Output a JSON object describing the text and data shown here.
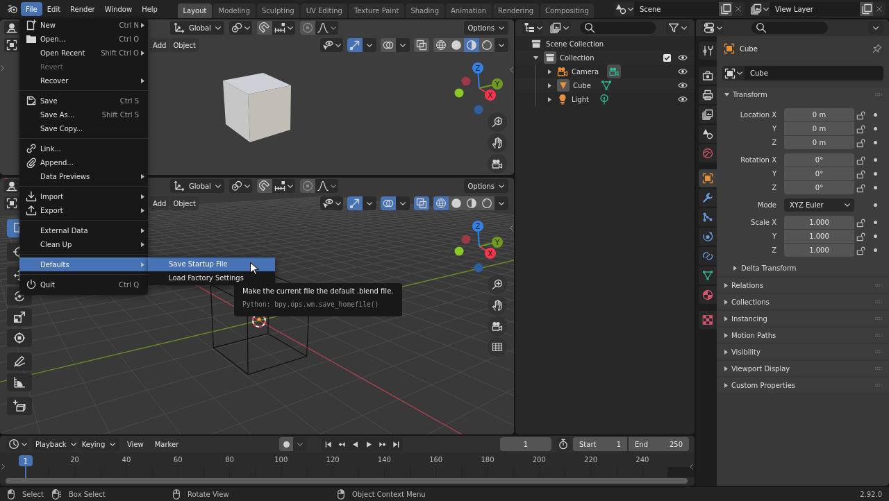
{
  "topbar": {
    "menus": [
      {
        "label": "File",
        "selected": true
      },
      {
        "label": "Edit",
        "selected": false
      },
      {
        "label": "Render",
        "selected": false
      },
      {
        "label": "Window",
        "selected": false
      },
      {
        "label": "Help",
        "selected": false
      }
    ],
    "workspaces": [
      {
        "label": "Layout",
        "selected": true
      },
      {
        "label": "Modeling",
        "selected": false
      },
      {
        "label": "Sculpting",
        "selected": false
      },
      {
        "label": "UV Editing",
        "selected": false
      },
      {
        "label": "Texture Paint",
        "selected": false
      },
      {
        "label": "Shading",
        "selected": false
      },
      {
        "label": "Animation",
        "selected": false
      },
      {
        "label": "Rendering",
        "selected": false
      },
      {
        "label": "Compositing",
        "selected": false
      }
    ],
    "scene": "Scene",
    "view_layer": "View Layer"
  },
  "viewports": [
    {
      "kind": "shaded",
      "orientation": "Global",
      "options": "Options",
      "menus": [
        "Add",
        "Object"
      ],
      "gizmos_on": true,
      "overlays_on": false,
      "xray_on": false,
      "shading": [
        {
          "kind": "wireframe",
          "selected": false
        },
        {
          "kind": "solid",
          "selected": false
        },
        {
          "kind": "material",
          "selected": true
        },
        {
          "kind": "rendered",
          "selected": false
        }
      ],
      "axes": [
        {
          "label": "X",
          "color": "#f5364f"
        },
        {
          "label": "Y",
          "color": "#6f9a1f"
        },
        {
          "label": "Z",
          "color": "#2f83e8"
        },
        {
          "color": "#9c3a47"
        },
        {
          "color": "#89c926"
        },
        {
          "color": "#2c5f9e"
        }
      ]
    },
    {
      "kind": "wireframe",
      "orientation": "Global",
      "options": "Options",
      "menus": [
        "Add",
        "Object"
      ],
      "gizmos_on": true,
      "overlays_on": true,
      "xray_on": true,
      "shading": [
        {
          "kind": "wireframe",
          "selected": true
        },
        {
          "kind": "solid",
          "selected": false
        },
        {
          "kind": "material",
          "selected": false
        },
        {
          "kind": "rendered",
          "selected": false
        }
      ],
      "axes": [
        {
          "label": "X",
          "color": "#f5364f"
        },
        {
          "label": "Y",
          "color": "#6f9a1f"
        },
        {
          "label": "Z",
          "color": "#2f83e8"
        },
        {
          "color": "#9c3a47"
        },
        {
          "color": "#89c926"
        },
        {
          "color": "#2c5f9e"
        }
      ],
      "toolbar": [
        [
          {
            "kind": "select_box",
            "selected": true
          }
        ],
        [
          {
            "kind": "cursor",
            "selected": false
          }
        ],
        [
          {
            "kind": "move",
            "selected": false
          },
          {
            "kind": "rotate",
            "selected": false
          },
          {
            "kind": "scale",
            "selected": false
          },
          {
            "kind": "transform",
            "selected": false
          }
        ],
        [
          {
            "kind": "annotate",
            "selected": false
          },
          {
            "kind": "measure",
            "selected": false
          }
        ],
        [
          {
            "kind": "add_cube",
            "selected": false
          }
        ]
      ]
    }
  ],
  "outliner": {
    "tree": [
      {
        "label": "Scene Collection",
        "kind": "scene_collection",
        "active": false,
        "children": [
          {
            "label": "Collection",
            "kind": "collection",
            "active": true,
            "expanded": true,
            "checked": true,
            "visible": true,
            "children": [
              {
                "label": "Camera",
                "kind": "camera",
                "active": false,
                "data_active": true,
                "expanded": false,
                "visible": true
              },
              {
                "label": "Cube",
                "kind": "mesh",
                "active": true,
                "data_active": false,
                "expanded": false,
                "visible": true
              },
              {
                "label": "Light",
                "kind": "light",
                "active": false,
                "data_active": false,
                "expanded": false,
                "visible": true
              }
            ]
          }
        ]
      }
    ]
  },
  "properties": {
    "tabs": [
      [
        {
          "kind": "tool",
          "selected": false
        }
      ],
      [
        {
          "kind": "render",
          "selected": false
        },
        {
          "kind": "output",
          "selected": false
        },
        {
          "kind": "view_layer",
          "selected": false
        },
        {
          "kind": "scene",
          "selected": false
        },
        {
          "kind": "world",
          "selected": false
        }
      ],
      [
        {
          "kind": "object",
          "selected": true
        },
        {
          "kind": "modifiers",
          "selected": false
        },
        {
          "kind": "particles",
          "selected": false
        },
        {
          "kind": "physics",
          "selected": false
        },
        {
          "kind": "constraints",
          "selected": false
        },
        {
          "kind": "data",
          "selected": false
        },
        {
          "kind": "material",
          "selected": false
        }
      ],
      [
        {
          "kind": "texture",
          "selected": false
        }
      ]
    ],
    "context": "Cube",
    "name": "Cube",
    "panels": [
      {
        "label": "Transform",
        "expanded": true,
        "groups": [
          [
            {
              "label": "Location X",
              "value": "0 m",
              "kind": "number",
              "locked": false
            },
            {
              "label": "Y",
              "value": "0 m",
              "kind": "number",
              "locked": false
            },
            {
              "label": "Z",
              "value": "0 m",
              "kind": "number",
              "locked": false
            }
          ],
          [
            {
              "label": "Rotation X",
              "value": "0°",
              "kind": "number",
              "locked": false
            },
            {
              "label": "Y",
              "value": "0°",
              "kind": "number",
              "locked": false
            },
            {
              "label": "Z",
              "value": "0°",
              "kind": "number",
              "locked": false
            }
          ],
          [
            {
              "label": "Mode",
              "value": "XYZ Euler",
              "kind": "dropdown"
            }
          ],
          [
            {
              "label": "Scale X",
              "value": "1.000",
              "kind": "number",
              "locked": false
            },
            {
              "label": "Y",
              "value": "1.000",
              "kind": "number",
              "locked": false
            },
            {
              "label": "Z",
              "value": "1.000",
              "kind": "number",
              "locked": false
            }
          ]
        ],
        "subpanels": [
          {
            "label": "Delta Transform",
            "expanded": false
          }
        ]
      },
      {
        "label": "Relations",
        "expanded": false
      },
      {
        "label": "Collections",
        "expanded": false
      },
      {
        "label": "Instancing",
        "expanded": false
      },
      {
        "label": "Motion Paths",
        "expanded": false
      },
      {
        "label": "Visibility",
        "expanded": false
      },
      {
        "label": "Viewport Display",
        "expanded": false
      },
      {
        "label": "Custom Properties",
        "expanded": false
      }
    ]
  },
  "timeline": {
    "menus": [
      {
        "label": "Playback",
        "kind": "dropdown"
      },
      {
        "label": "Keying",
        "kind": "dropdown"
      },
      {
        "label": "View",
        "kind": "menu"
      },
      {
        "label": "Marker",
        "kind": "menu"
      }
    ],
    "auto_keying": false,
    "current_frame": "1",
    "preview_range": false,
    "start": {
      "label": "Start",
      "value": "1"
    },
    "end": {
      "label": "End",
      "value": "250"
    },
    "playhead": "1",
    "ticks": [
      "20",
      "40",
      "60",
      "80",
      "100",
      "120",
      "140",
      "160",
      "180",
      "200",
      "220",
      "240"
    ]
  },
  "status": {
    "hints": [
      "Select",
      "Box Select",
      "Rotate View",
      "Object Context Menu"
    ],
    "version": "2.92.0"
  },
  "file_menu": {
    "groups": [
      [
        {
          "label": "New",
          "shortcut": "Ctrl N",
          "submenu": true,
          "disabled": false,
          "selected": false
        },
        {
          "label": "Open...",
          "shortcut": "Ctrl O",
          "submenu": false,
          "disabled": false,
          "selected": false
        },
        {
          "label": "Open Recent",
          "shortcut": "Shift Ctrl O",
          "submenu": true,
          "disabled": false,
          "selected": false
        },
        {
          "label": "Revert",
          "submenu": false,
          "disabled": true,
          "selected": false
        },
        {
          "label": "Recover",
          "submenu": true,
          "disabled": false,
          "selected": false
        }
      ],
      [
        {
          "label": "Save",
          "shortcut": "Ctrl S",
          "submenu": false,
          "disabled": false,
          "selected": false
        },
        {
          "label": "Save As...",
          "shortcut": "Shift Ctrl S",
          "submenu": false,
          "disabled": false,
          "selected": false
        },
        {
          "label": "Save Copy...",
          "submenu": false,
          "disabled": false,
          "selected": false
        }
      ],
      [
        {
          "label": "Link...",
          "submenu": false,
          "disabled": false,
          "selected": false
        },
        {
          "label": "Append...",
          "submenu": false,
          "disabled": false,
          "selected": false
        },
        {
          "label": "Data Previews",
          "submenu": true,
          "disabled": false,
          "selected": false
        }
      ],
      [
        {
          "label": "Import",
          "submenu": true,
          "disabled": false,
          "selected": false
        },
        {
          "label": "Export",
          "submenu": true,
          "disabled": false,
          "selected": false
        }
      ],
      [
        {
          "label": "External Data",
          "submenu": true,
          "disabled": false,
          "selected": false
        },
        {
          "label": "Clean Up",
          "submenu": true,
          "disabled": false,
          "selected": false
        }
      ],
      [
        {
          "label": "Defaults",
          "submenu": true,
          "disabled": false,
          "selected": true
        }
      ],
      [
        {
          "label": "Quit",
          "shortcut": "Ctrl Q",
          "submenu": false,
          "disabled": false,
          "selected": false
        }
      ]
    ]
  },
  "submenu": {
    "items": [
      {
        "label": "Save Startup File",
        "selected": true
      },
      {
        "label": "Load Factory Settings",
        "selected": false
      }
    ]
  },
  "tooltip": {
    "text": "Make the current file the default .blend file.",
    "python": "Python: bpy.ops.wm.save_homefile()"
  }
}
